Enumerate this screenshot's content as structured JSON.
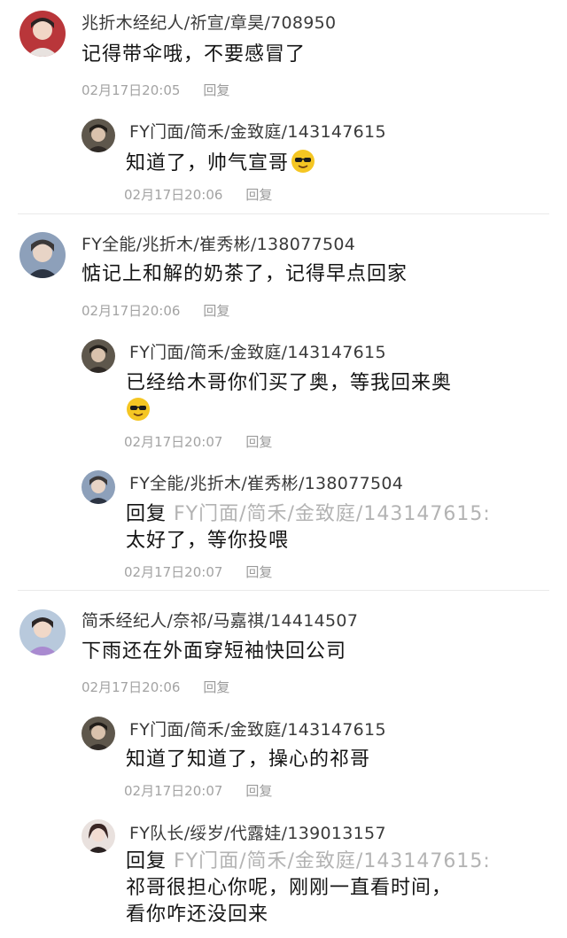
{
  "comments": [
    {
      "author": "兆折木经纪人/祈宣/章昊/708950",
      "text": "记得带伞哦，不要感冒了",
      "time": "02月17日20:05",
      "reply_label": "回复",
      "replies": [
        {
          "author": "FY门面/简禾/金致庭/143147615",
          "text": "知道了，帅气宣哥",
          "emoji": "sunglasses-emoji",
          "time": "02月17日20:06",
          "reply_label": "回复"
        }
      ]
    },
    {
      "author": "FY全能/兆折木/崔秀彬/138077504",
      "text": "惦记上和解的奶茶了，记得早点回家",
      "time": "02月17日20:06",
      "reply_label": "回复",
      "replies": [
        {
          "author": "FY门面/简禾/金致庭/143147615",
          "text_line1": "已经给木哥你们买了奥，等我回来奥",
          "emoji": "sunglasses-emoji",
          "time": "02月17日20:07",
          "reply_label": "回复"
        },
        {
          "author": "FY全能/兆折木/崔秀彬/138077504",
          "reply_prefix": "回复",
          "reply_target": "FY门面/简禾/金致庭/143147615:",
          "text": "太好了，等你投喂",
          "time": "02月17日20:07",
          "reply_label": "回复"
        }
      ]
    },
    {
      "author": "简禾经纪人/奈祁/马嘉祺/14414507",
      "text": "下雨还在外面穿短袖快回公司",
      "time": "02月17日20:06",
      "reply_label": "回复",
      "replies": [
        {
          "author": "FY门面/简禾/金致庭/143147615",
          "text": "知道了知道了，操心的祁哥",
          "time": "02月17日20:07",
          "reply_label": "回复"
        },
        {
          "author": "FY队长/绥岁/代露娃/139013157",
          "reply_prefix": "回复",
          "reply_target": "FY门面/简禾/金致庭/143147615:",
          "text_line1": "祁哥很担心你呢，刚刚一直看时间，",
          "text_line2": "看你咋还没回来"
        }
      ]
    }
  ]
}
